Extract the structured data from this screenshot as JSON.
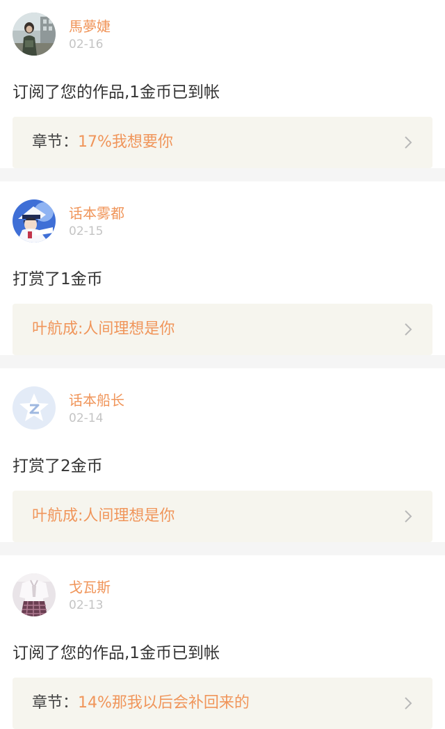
{
  "notifications": [
    {
      "username": "馬夢婕",
      "date": "02-16",
      "action": "订阅了您的作品,1金币已到帐",
      "link_prefix": "章节：",
      "link_text": "17%我想要你",
      "avatar_kind": "photo-person"
    },
    {
      "username": "话本雾都",
      "date": "02-15",
      "action": "打赏了1金币",
      "link_prefix": "",
      "link_text": "叶航成:人间理想是你",
      "avatar_kind": "photo-anime"
    },
    {
      "username": "话本船长",
      "date": "02-14",
      "action": "打赏了2金币",
      "link_prefix": "",
      "link_text": "叶航成:人间理想是你",
      "avatar_kind": "default-z-star"
    },
    {
      "username": "戈瓦斯",
      "date": "02-13",
      "action": "订阅了您的作品,1金币已到帐",
      "link_prefix": "章节：",
      "link_text": "14%那我以后会补回来的",
      "avatar_kind": "photo-clothing"
    }
  ],
  "colors": {
    "accent": "#f0955a",
    "date": "#c4c4c4",
    "link_bg": "#f6f5ee",
    "separator": "#f5f5f5"
  },
  "icons": {
    "link_arrow": "chevron-right-icon"
  }
}
